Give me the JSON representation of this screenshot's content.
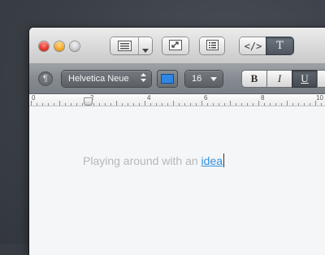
{
  "toolbar": {
    "format_icon": "paragraph-format-icon",
    "format_menu_icon": "chevron-down-icon",
    "fullscreen_icon": "expand-arrows-icon",
    "outline_icon": "list-icon",
    "code_label": "</>",
    "text_mode_label": "T"
  },
  "formatbar": {
    "paragraph_symbol": "¶",
    "font_family": "Helvetica Neue",
    "font_size": "16",
    "text_color": "#2f86e3",
    "bold_label": "B",
    "italic_label": "I",
    "underline_label": "U",
    "underline_active": true
  },
  "ruler": {
    "labels": [
      "0",
      "2",
      "4",
      "6",
      "8",
      "10"
    ]
  },
  "document": {
    "text_before": "Playing around with an ",
    "link_text": "idea"
  }
}
